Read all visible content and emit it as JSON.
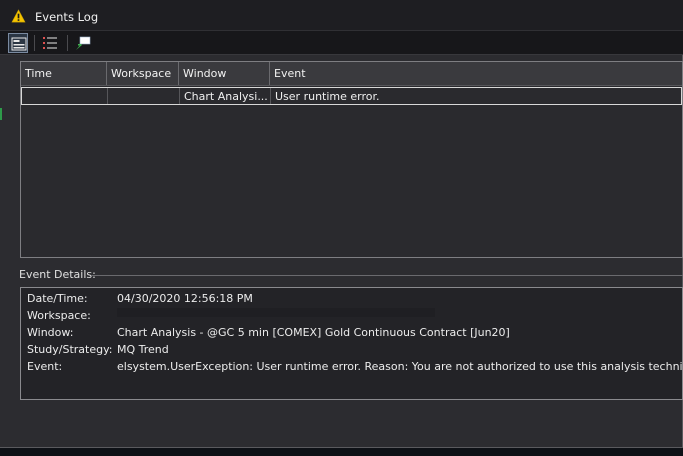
{
  "window": {
    "title": "Events Log"
  },
  "icons": {
    "title": "warning-icon",
    "toolbar": [
      "layout-view-icon",
      "list-view-icon",
      "flag-icon"
    ]
  },
  "grid": {
    "columns": [
      "Time",
      "Workspace",
      "Window",
      "Event"
    ],
    "rows": [
      {
        "time": "",
        "workspace": "",
        "window": "Chart Analysi...",
        "event": "User runtime error."
      }
    ]
  },
  "details": {
    "section_label": "Event Details:",
    "fields": [
      {
        "label": "Date/Time:",
        "value": "04/30/2020 12:56:18 PM"
      },
      {
        "label": "Workspace:",
        "value": ""
      },
      {
        "label": "Window:",
        "value": "Chart Analysis - @GC 5 min [COMEX] Gold Continuous Contract [Jun20]"
      },
      {
        "label": "Study/Strategy:",
        "value": "MQ Trend"
      },
      {
        "label": "Event:",
        "value": "elsystem.UserException: User runtime error. Reason: You are not authorized to use this analysis technique."
      }
    ]
  },
  "colors": {
    "accent": "#f5c400",
    "background": "#2c2c30",
    "selection_border": "#d8d8d8"
  }
}
